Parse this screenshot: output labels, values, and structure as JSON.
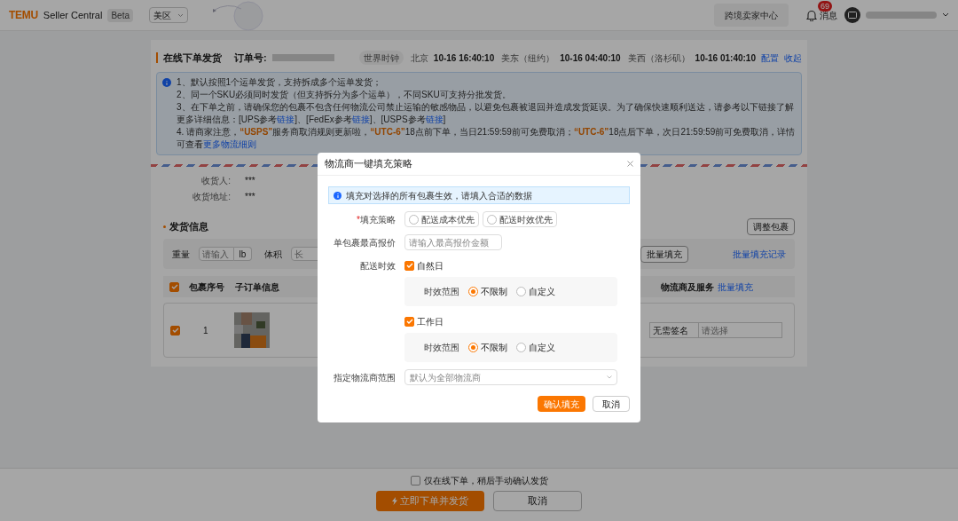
{
  "header": {
    "logo": "TEMU",
    "app_name": "Seller Central",
    "badge": "Beta",
    "region": "美区",
    "center_button": "跨境卖家中心",
    "messages": {
      "label": "消息",
      "count": "69"
    }
  },
  "order": {
    "title": "在线下单发货",
    "order_label": "订单号:",
    "world_clock": "世界时钟",
    "clocks": [
      {
        "city": "北京",
        "time": "10-16 16:40:10"
      },
      {
        "city": "美东（纽约）",
        "time": "10-16 04:40:10"
      },
      {
        "city": "美西（洛杉矶）",
        "time": "10-16 01:40:10"
      }
    ],
    "links": [
      "配置",
      "收起"
    ]
  },
  "notice": [
    [
      {
        "kind": "plain",
        "text": "1、默认按照1个运单发货，支持拆成多个运单发货；"
      }
    ],
    [
      {
        "kind": "plain",
        "text": "2、同一个SKU必须同时发货（但支持拆分为多个运单），不同SKU可支持分批发货。"
      }
    ],
    [
      {
        "kind": "plain",
        "text": "3、在下单之前，请确保您的包裹不包含任何物流公司禁止运输的敏感物品，以避免包裹被退回并造成发货延误。为了确保快速顺利送达，请参考以下链接了解更多详细信息：[UPS参考"
      },
      {
        "kind": "link",
        "text": "链接"
      },
      {
        "kind": "plain",
        "text": "]、[FedEx参考"
      },
      {
        "kind": "link",
        "text": "链接"
      },
      {
        "kind": "plain",
        "text": "]、[USPS参考"
      },
      {
        "kind": "link",
        "text": "链接"
      },
      {
        "kind": "plain",
        "text": "]"
      }
    ],
    [
      {
        "kind": "plain",
        "text": "4. 请商家注意，"
      },
      {
        "kind": "highlight",
        "text": "“USPS”"
      },
      {
        "kind": "plain",
        "text": "服务商取消规则更新啦，"
      },
      {
        "kind": "highlight",
        "text": "“UTC-6”"
      },
      {
        "kind": "plain",
        "text": "18点前下单，当日21:59:59前可免费取消；"
      },
      {
        "kind": "highlight",
        "text": "“UTC-6”"
      },
      {
        "kind": "plain",
        "text": "18点后下单，次日21:59:59前可免费取消，详情可查看"
      },
      {
        "kind": "link",
        "text": "更多物流细则"
      }
    ]
  ],
  "recipient": [
    {
      "label": "收货人:",
      "value": "***"
    },
    {
      "label": "收货地址:",
      "value": "***"
    }
  ],
  "shipping": {
    "title": "发货信息",
    "adjust_button": "调整包裹",
    "filters": {
      "weight_label": "重量",
      "weight_placeholder": "请输入",
      "weight_unit": "lb",
      "volume_label": "体积",
      "length_placeholder": "长",
      "batch_fill_button": "批量填充",
      "batch_record_link": "批量填充记录"
    },
    "table": {
      "all_checked": true,
      "columns": [
        "包裹序号",
        "子订单信息",
        "物流商及服务"
      ],
      "column_link": "批量填充",
      "rows": [
        {
          "checked": true,
          "index": "1",
          "signature": "无需签名",
          "service_placeholder": "请选择"
        }
      ]
    }
  },
  "footer": {
    "option": {
      "label": "仅在线下单，稍后手动确认发货",
      "checked": false
    },
    "primary_button": "立即下单并发货",
    "cancel_button": "取消"
  },
  "modal": {
    "title": "物流商一键填充策略",
    "info": "填充对选择的所有包裹生效，请填入合适的数据",
    "strategy": {
      "label": "填充策略",
      "required_mark": "*",
      "options": [
        {
          "label": "配送成本优先",
          "selected": false
        },
        {
          "label": "配送时效优先",
          "selected": false
        }
      ]
    },
    "max_price": {
      "label": "单包裹最高报价",
      "placeholder": "请输入最高报价金额"
    },
    "delivery": {
      "label": "配送时效",
      "groups": [
        {
          "label": "自然日",
          "checked": true,
          "range_label": "时效范围",
          "options": [
            {
              "label": "不限制",
              "selected": true
            },
            {
              "label": "自定义",
              "selected": false
            }
          ]
        },
        {
          "label": "工作日",
          "checked": true,
          "range_label": "时效范围",
          "options": [
            {
              "label": "不限制",
              "selected": true
            },
            {
              "label": "自定义",
              "selected": false
            }
          ]
        }
      ]
    },
    "carrier": {
      "label": "指定物流商范围",
      "placeholder": "默认为全部物流商"
    },
    "confirm_button": "确认填充",
    "cancel_button": "取消"
  }
}
